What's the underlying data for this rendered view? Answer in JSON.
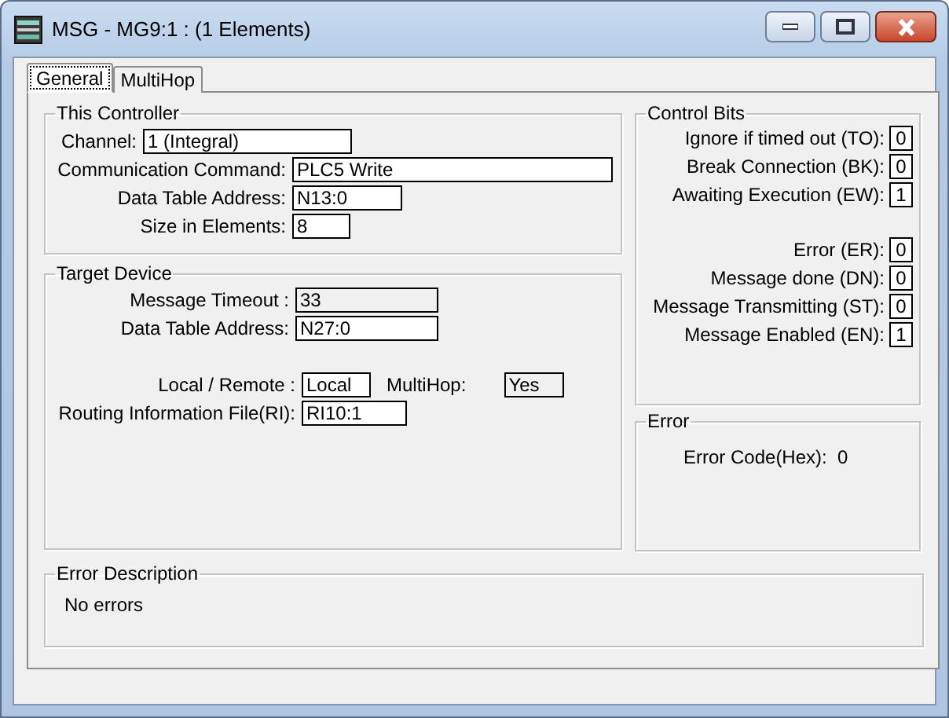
{
  "window": {
    "title": "MSG - MG9:1 : (1 Elements)"
  },
  "tabs": [
    {
      "label": "General",
      "selected": true
    },
    {
      "label": "MultiHop",
      "selected": false
    }
  ],
  "this_controller": {
    "title": "This Controller",
    "fields": [
      {
        "label": "Channel:",
        "value": "1 (Integral)",
        "disabled": false
      },
      {
        "label": "Communication Command:",
        "value": "PLC5 Write",
        "disabled": false
      },
      {
        "label": "Data Table Address:",
        "value": "N13:0",
        "disabled": false
      },
      {
        "label": "Size in Elements:",
        "value": "8",
        "disabled": false
      }
    ]
  },
  "target_device": {
    "title": "Target Device",
    "fields": [
      {
        "label": "Message Timeout :",
        "value": "33",
        "disabled": true
      },
      {
        "label": "Data Table Address:",
        "value": "N27:0",
        "disabled": false
      }
    ],
    "location": [
      {
        "label": "Local / Remote :",
        "value": "Local",
        "disabled": false
      },
      {
        "label": "MultiHop:",
        "value": "Yes",
        "disabled": true
      }
    ],
    "routing": {
      "label": "Routing Information File(RI):",
      "value": "RI10:1",
      "disabled": false
    }
  },
  "control_bits": {
    "title": "Control Bits",
    "groups": [
      [
        {
          "label": "Ignore if timed out (TO):",
          "value": "0"
        },
        {
          "label": "Break Connection (BK):",
          "value": "0"
        },
        {
          "label": "Awaiting Execution (EW):",
          "value": "1"
        }
      ],
      [
        {
          "label": "Error (ER):",
          "value": "0"
        },
        {
          "label": "Message done (DN):",
          "value": "0"
        },
        {
          "label": "Message Transmitting (ST):",
          "value": "0"
        },
        {
          "label": "Message Enabled (EN):",
          "value": "1"
        }
      ]
    ]
  },
  "error": {
    "title": "Error",
    "label": "Error Code(Hex):",
    "value": "0"
  },
  "error_description": {
    "title": "Error Description",
    "text": "No errors"
  }
}
